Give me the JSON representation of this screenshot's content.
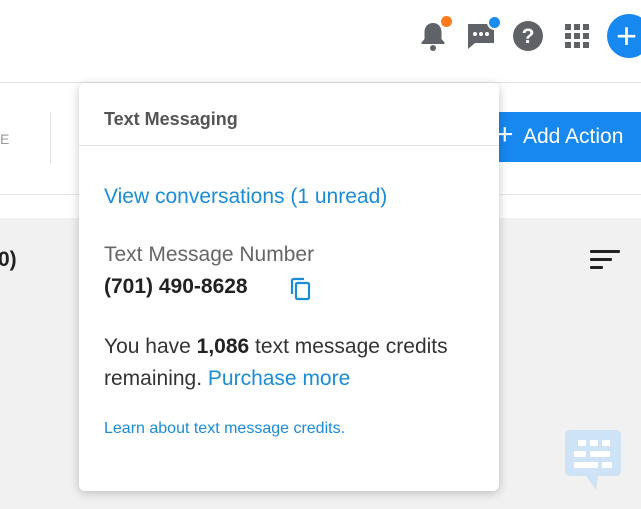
{
  "header": {
    "icons": [
      "bell-icon",
      "chat-icon",
      "help-icon",
      "apps-grid-icon",
      "plus-icon"
    ],
    "badge_colors": {
      "bell": "#ff7a1a",
      "chat": "#1a8cf0"
    },
    "add_button_symbol": "+"
  },
  "toolbar": {
    "fragment_text": "E",
    "add_action_plus": "+",
    "add_action_label": "Add Action"
  },
  "content": {
    "count_fragment": "0)"
  },
  "popover": {
    "title": "Text Messaging",
    "view_conversations_link": "View conversations (1 unread)",
    "number_label": "Text Message Number",
    "number_value": "(701) 490-8628",
    "credits_prefix": "You have ",
    "credits_count": "1,086",
    "credits_suffix": " text message credits remaining. ",
    "purchase_link": "Purchase more",
    "learn_link": "Learn about text message credits."
  },
  "colors": {
    "accent": "#1688f0",
    "link": "#1a8cd8"
  }
}
